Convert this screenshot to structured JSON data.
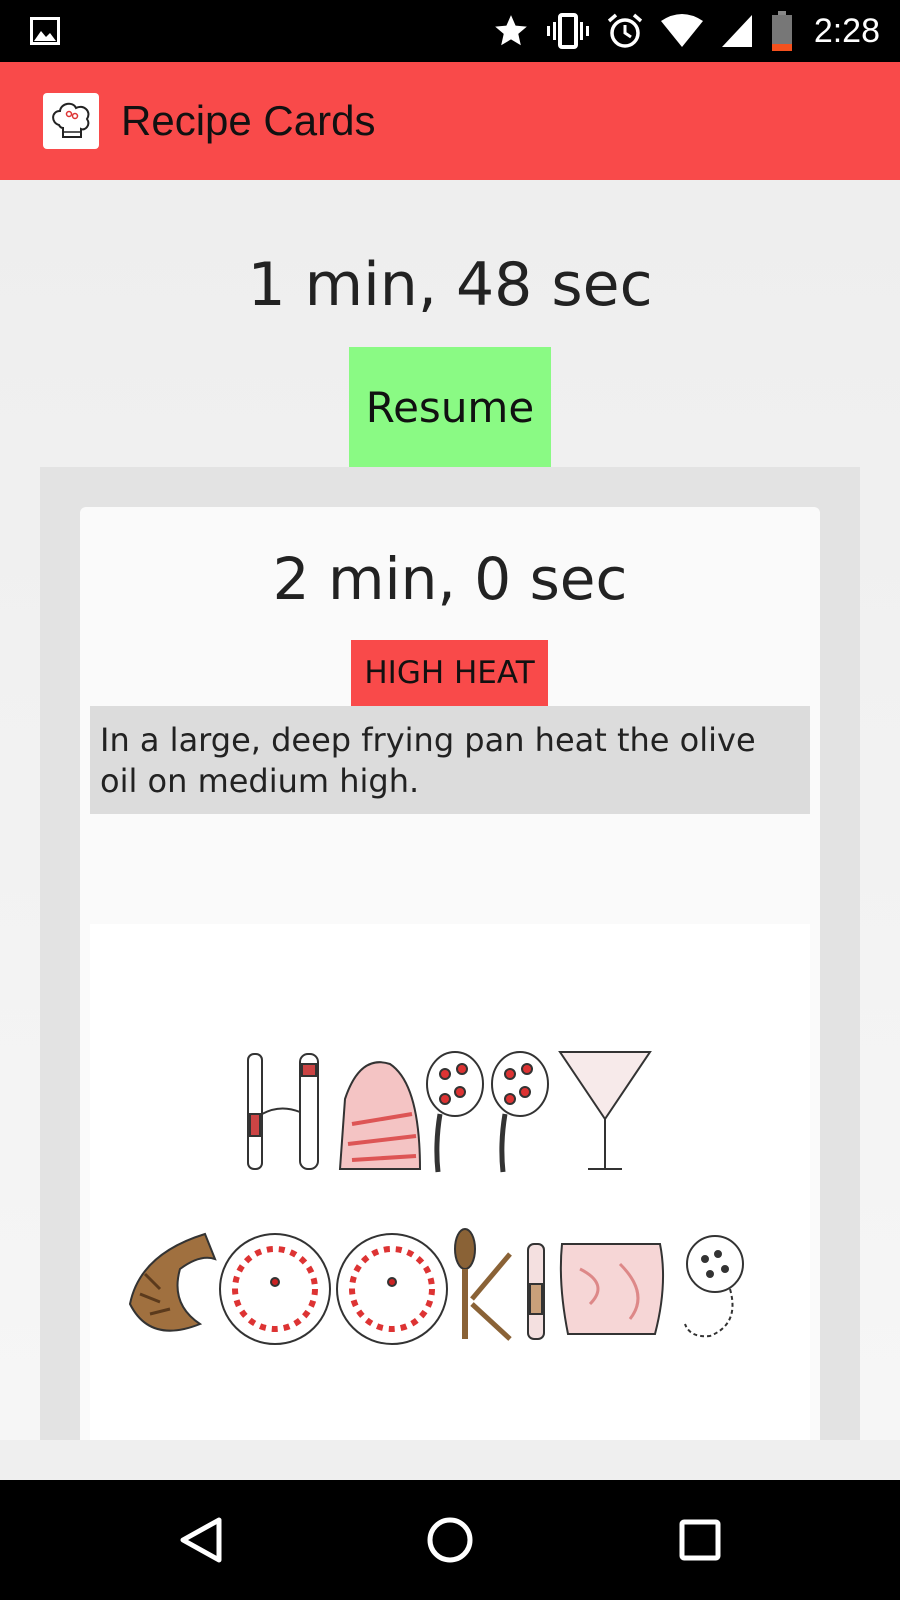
{
  "status_bar": {
    "time": "2:28",
    "icons": [
      "gallery-icon",
      "star-icon",
      "vibrate-icon",
      "alarm-icon",
      "wifi-icon",
      "cell-signal-icon",
      "battery-icon"
    ]
  },
  "app_bar": {
    "title": "Recipe Cards",
    "logo_icon": "chef-hat-icon"
  },
  "main_timer": {
    "value": "1 min, 48 sec",
    "resume_label": "Resume",
    "resume_color": "#8afa84"
  },
  "steps": [
    {
      "timer": "2 min, 0 sec",
      "heat_label": "HIGH HEAT",
      "heat_color": "#f94a4a",
      "instruction": "In a large, deep frying pan heat the olive oil on medium high.",
      "image": {
        "line1": "HAPPY",
        "line2": "COOKING"
      }
    }
  ],
  "nav_bar": {
    "buttons": [
      "back-icon",
      "home-icon",
      "recents-icon"
    ]
  },
  "colors": {
    "accent": "#f94a4a",
    "resume": "#8afa84"
  }
}
